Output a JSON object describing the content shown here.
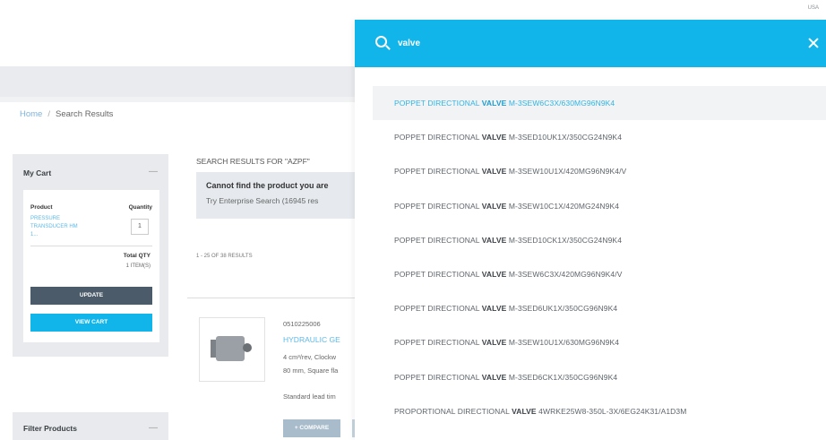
{
  "header": {
    "region": "USA"
  },
  "breadcrumb": {
    "home": "Home",
    "separator": "/",
    "current": "Search Results"
  },
  "cart": {
    "title": "My Cart",
    "collapse_icon": "minus-icon",
    "product_col": "Product",
    "quantity_col": "Quantity",
    "product_name": "PRESSURE TRANSDUCER HM 1...",
    "quantity": "1",
    "total_label": "Total QTY",
    "total_value": "1 ITEM(S)",
    "update_label": "UPDATE",
    "view_cart_label": "VIEW CART"
  },
  "filter": {
    "title": "Filter Products",
    "collapse_icon": "minus-icon"
  },
  "results": {
    "heading": "SEARCH RESULTS FOR \"AZPF\"",
    "notice_title": "Cannot find the product you are",
    "notice_sub": "Try Enterprise Search (16945 res",
    "count": "1 - 25 OF 38 RESULTS",
    "product": {
      "sku": "0510225006",
      "name": "HYDRAULIC GE",
      "desc1": "4 cm³/rev, Clockw",
      "desc2": "80 mm, Square fla",
      "lead": "Standard lead tim",
      "compare_label": "+ COMPARE"
    }
  },
  "search": {
    "query": "valve",
    "accent_color": "#12b5ea",
    "search_icon": "search-icon",
    "close_icon": "close-icon",
    "suggestions": [
      {
        "prefix": "POPPET DIRECTIONAL ",
        "match": "VALVE",
        "suffix": " M-3SEW6C3X/630MG96N9K4"
      },
      {
        "prefix": "POPPET DIRECTIONAL ",
        "match": "VALVE",
        "suffix": " M-3SED10UK1X/350CG24N9K4"
      },
      {
        "prefix": "POPPET DIRECTIONAL ",
        "match": "VALVE",
        "suffix": " M-3SEW10U1X/420MG96N9K4/V"
      },
      {
        "prefix": "POPPET DIRECTIONAL ",
        "match": "VALVE",
        "suffix": " M-3SEW10C1X/420MG24N9K4"
      },
      {
        "prefix": "POPPET DIRECTIONAL ",
        "match": "VALVE",
        "suffix": " M-3SED10CK1X/350CG24N9K4"
      },
      {
        "prefix": "POPPET DIRECTIONAL ",
        "match": "VALVE",
        "suffix": " M-3SEW6C3X/420MG96N9K4/V"
      },
      {
        "prefix": "POPPET DIRECTIONAL ",
        "match": "VALVE",
        "suffix": " M-3SED6UK1X/350CG96N9K4"
      },
      {
        "prefix": "POPPET DIRECTIONAL ",
        "match": "VALVE",
        "suffix": " M-3SEW10U1X/630MG96N9K4"
      },
      {
        "prefix": "POPPET DIRECTIONAL ",
        "match": "VALVE",
        "suffix": " M-3SED6CK1X/350CG96N9K4"
      },
      {
        "prefix": "PROPORTIONAL DIRECTIONAL ",
        "match": "VALVE",
        "suffix": " 4WRKE25W8-350L-3X/6EG24K31/A1D3M"
      }
    ]
  }
}
